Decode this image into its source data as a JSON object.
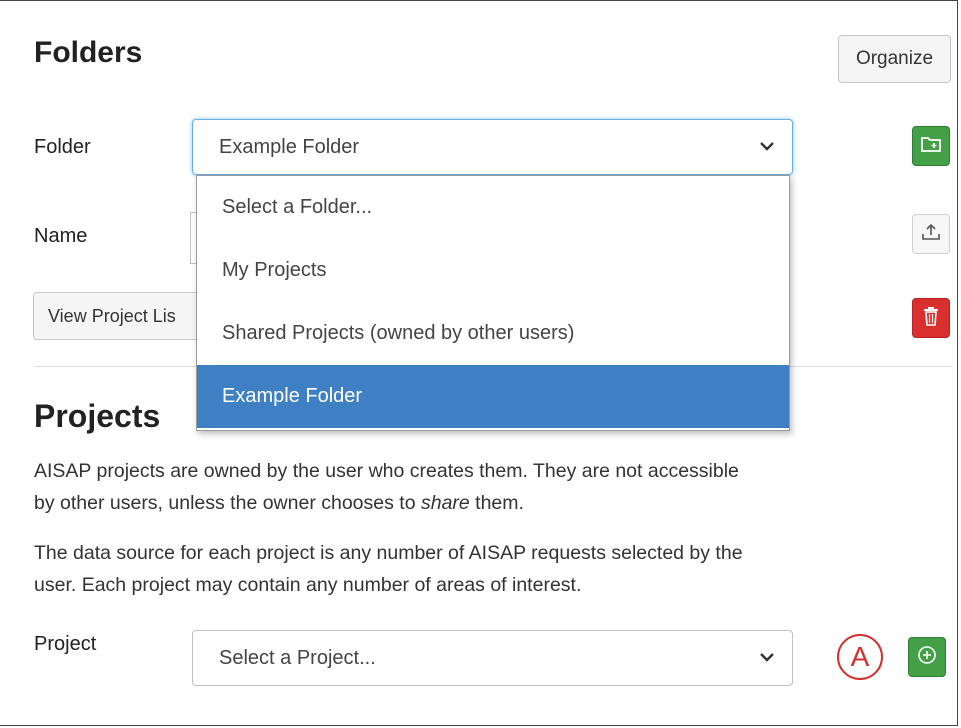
{
  "folders": {
    "heading": "Folders",
    "organize_label": "Organize",
    "folder_label": "Folder",
    "folder_value": "Example Folder",
    "name_label": "Name",
    "view_project_list_label": "View Project Lis",
    "dropdown_options": [
      {
        "label": "Select a Folder...",
        "selected": false
      },
      {
        "label": "My Projects",
        "selected": false
      },
      {
        "label": "Shared Projects (owned by other users)",
        "selected": false
      },
      {
        "label": "Example Folder",
        "selected": true
      }
    ],
    "icons": {
      "new_folder": "folder-plus-icon",
      "upload": "upload-icon",
      "delete": "trash-icon"
    }
  },
  "projects": {
    "heading": "Projects",
    "para1_a": "AISAP projects are owned by the user who creates them. They are not accessible",
    "para1_b": "by other users, unless the owner chooses to ",
    "para1_em": "share",
    "para1_c": " them.",
    "para2_a": "The data source for each project is any number of AISAP requests selected by the",
    "para2_b": "user. Each project may contain any number of areas of interest.",
    "project_label": "Project",
    "project_placeholder": "Select a Project...",
    "callout": "A",
    "icons": {
      "add": "plus-circle-icon"
    }
  },
  "colors": {
    "green": "#43a047",
    "red": "#d9302f",
    "selected_blue": "#3f7fc3",
    "focus_border": "#66afe9",
    "callout_red": "#d32f2f"
  }
}
